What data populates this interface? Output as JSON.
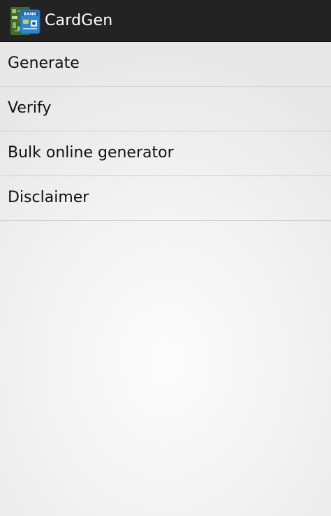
{
  "action_bar": {
    "title": "CardGen",
    "icon": "app-card-icon",
    "icon_text": "BANK",
    "background": "#232323"
  },
  "menu": {
    "items": [
      {
        "label": "Generate"
      },
      {
        "label": "Verify"
      },
      {
        "label": "Bulk online generator"
      },
      {
        "label": "Disclaimer"
      }
    ]
  }
}
